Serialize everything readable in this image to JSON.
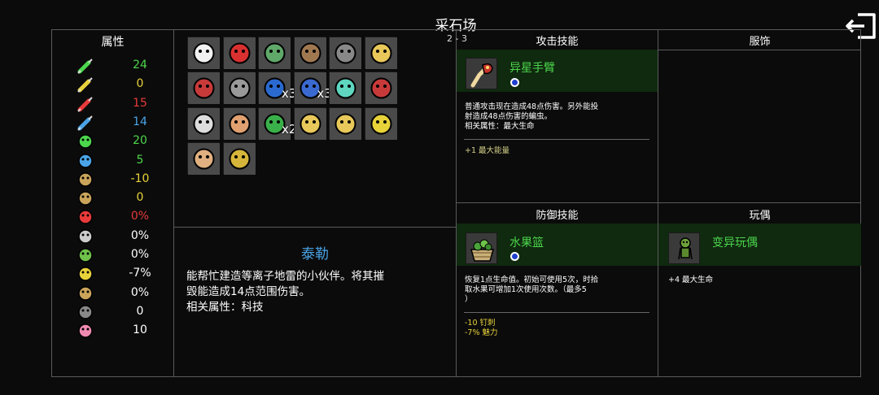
{
  "screen": {
    "title": "采石场",
    "page": "2 - 3"
  },
  "stats": {
    "header": "属性",
    "rows": [
      {
        "icon": "green-syringe-icon",
        "value": "24",
        "color": "#4cd64c"
      },
      {
        "icon": "yellow-syringe-icon",
        "value": "0",
        "color": "#e8d23a"
      },
      {
        "icon": "red-syringe-icon",
        "value": "15",
        "color": "#e83a3a"
      },
      {
        "icon": "blue-syringe-icon",
        "value": "14",
        "color": "#4aa3e6"
      },
      {
        "icon": "green-creature-icon",
        "value": "20",
        "color": "#4cd64c"
      },
      {
        "icon": "blue-orb-icon",
        "value": "5",
        "color": "#4cd64c"
      },
      {
        "icon": "brain-icon",
        "value": "-10",
        "color": "#e8d23a"
      },
      {
        "icon": "sack-icon",
        "value": "0",
        "color": "#e8d23a"
      },
      {
        "icon": "eye-creature-icon",
        "value": "0%",
        "color": "#e83a3a"
      },
      {
        "icon": "magnet-icon",
        "value": "0%",
        "color": "#ffffff"
      },
      {
        "icon": "leaf-icon",
        "value": "0%",
        "color": "#ffffff"
      },
      {
        "icon": "tooth-creature-icon",
        "value": "-7%",
        "color": "#ffffff"
      },
      {
        "icon": "gem-ticket-icon",
        "value": "0%",
        "color": "#ffffff"
      },
      {
        "icon": "helmet-icon",
        "value": "0",
        "color": "#ffffff"
      },
      {
        "icon": "pig-icon",
        "value": "10",
        "color": "#ffffff"
      }
    ]
  },
  "items": [
    {
      "icon": "ghost-face-icon",
      "count": ""
    },
    {
      "icon": "bloody-heart-icon",
      "count": ""
    },
    {
      "icon": "green-brain-jar-icon",
      "count": ""
    },
    {
      "icon": "teddy-bear-icon",
      "count": ""
    },
    {
      "icon": "spiked-chain-icon",
      "count": ""
    },
    {
      "icon": "bird-robot-icon",
      "count": ""
    },
    {
      "icon": "red-syringe-item-icon",
      "count": ""
    },
    {
      "icon": "spider-icon",
      "count": ""
    },
    {
      "icon": "blue-syringe-item-icon",
      "count": "x3"
    },
    {
      "icon": "blue-hook-icon",
      "count": "x3"
    },
    {
      "icon": "cyan-ghost-icon",
      "count": ""
    },
    {
      "icon": "dynamite-icon",
      "count": ""
    },
    {
      "icon": "germ-plate-icon",
      "count": ""
    },
    {
      "icon": "scientist-icon",
      "count": ""
    },
    {
      "icon": "green-syringe-item-icon",
      "count": "x2"
    },
    {
      "icon": "yellow-arm-icon",
      "count": ""
    },
    {
      "icon": "golden-foot-icon",
      "count": ""
    },
    {
      "icon": "yellow-wizard-icon",
      "count": ""
    },
    {
      "icon": "cat-icon",
      "count": ""
    },
    {
      "icon": "yellow-robot-icon",
      "count": ""
    }
  ],
  "description": {
    "title": "泰勒",
    "lines": [
      "能帮忙建造等离子地雷的小伙伴。将其摧",
      "毁能造成14点范围伤害。",
      "相关属性：科技"
    ]
  },
  "attack_skill": {
    "header": "攻击技能",
    "icon": "alien-arm-icon",
    "name": "异星手臂",
    "desc": [
      "普通攻击现在造成48点伤害。另外能投",
      "射造成48点伤害的蝙虫。",
      "相关属性：最大生命"
    ],
    "bonuses": [
      {
        "text": "+1 最大能量",
        "color": "#d4d08a"
      }
    ]
  },
  "clothing": {
    "header": "服饰"
  },
  "defense_skill": {
    "header": "防御技能",
    "icon": "fruit-basket-icon",
    "name": "水果篮",
    "desc": [
      "恢复1点生命值。初始可使用5次，时拾",
      "取水果可增加1次使用次数。（最多5",
      "）"
    ],
    "bonuses": [
      {
        "text": "-10 钉刺",
        "color": "#e8d23a"
      },
      {
        "text": "-7% 魅力",
        "color": "#e8d23a"
      }
    ]
  },
  "toy": {
    "header": "玩偶",
    "icon": "mutant-doll-icon",
    "name": "变异玩偶",
    "bonuses": [
      {
        "text": "+4 最大生命",
        "color": "#ffffff"
      }
    ]
  },
  "colors": {
    "accent_green": "#4cd64c",
    "accent_blue": "#4aa3e6",
    "border": "#5a5a5a"
  }
}
